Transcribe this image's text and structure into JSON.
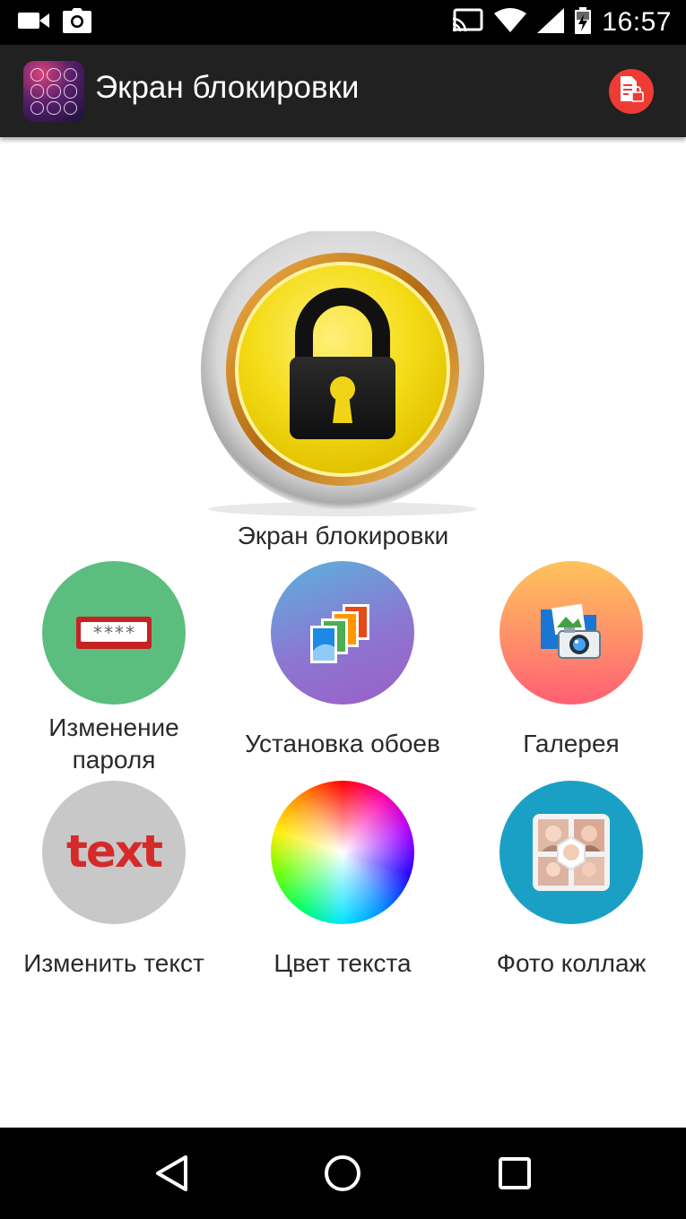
{
  "status_bar": {
    "time": "16:57",
    "icons": [
      "videocam-icon",
      "camera-icon",
      "cast-icon",
      "wifi-icon",
      "signal-icon",
      "battery-charging-icon"
    ]
  },
  "toolbar": {
    "title": "Экран блокировки",
    "app_icon": "keypad-lock-app-icon",
    "action_icon": "locked-document-icon"
  },
  "main": {
    "lock_label": "Экран блокировки",
    "lock_icon": "padlock-icon"
  },
  "tiles": [
    {
      "label": "Изменение\nпароля",
      "icon": "password-field-icon",
      "color": "#5bbe7f"
    },
    {
      "label": "Установка обоев",
      "icon": "wallpapers-icon",
      "color": "#8e6ad1"
    },
    {
      "label": "Галерея",
      "icon": "gallery-camera-icon",
      "color": "#ff7d6e"
    },
    {
      "label": "Изменить текст",
      "icon": "text-icon",
      "color": "#c8c8c8"
    },
    {
      "label": "Цвет текста",
      "icon": "color-wheel-icon",
      "color": "#ffffff"
    },
    {
      "label": "Фото коллаж",
      "icon": "photo-collage-icon",
      "color": "#1aa0c4"
    }
  ],
  "nav_bar": {
    "icons": [
      "back-icon",
      "home-icon",
      "recents-icon"
    ]
  }
}
